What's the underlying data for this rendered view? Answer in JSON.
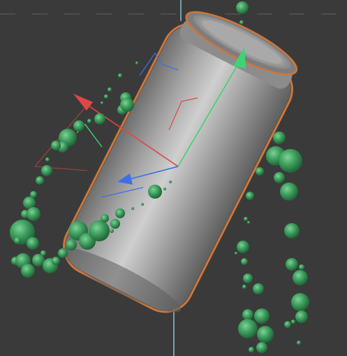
{
  "viewport": {
    "background_color": "#3a3a3a",
    "grid_line_color": "#5a5a5a",
    "world_z_axis_color": "#8fd0e0"
  },
  "scene": {
    "object": "aluminum-can",
    "object_color": "#9a9a9a",
    "selection_outline_color": "#d0763a",
    "particle_color": "#3fa15f"
  },
  "gizmo": {
    "type": "move-gizmo",
    "x_axis_color": "#e04646",
    "y_axis_color": "#3fd276",
    "z_axis_color": "#3d6fe8"
  }
}
